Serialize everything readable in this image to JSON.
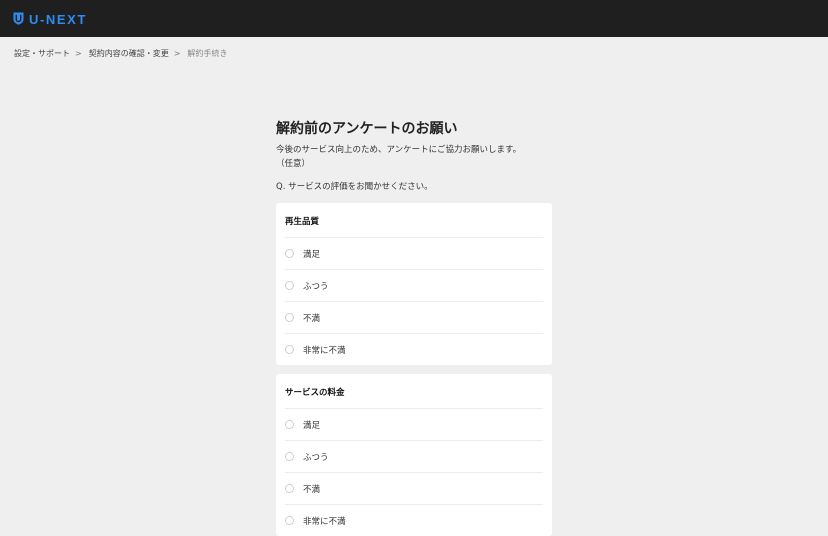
{
  "header": {
    "logo_text": "U-NEXT",
    "logo_icon": "u-next-shield-icon"
  },
  "breadcrumb": [
    {
      "label": "設定・サポート"
    },
    {
      "label": "契約内容の確認・変更"
    },
    {
      "label": "解約手続き"
    }
  ],
  "breadcrumb_sep": ">",
  "survey": {
    "title": "解約前のアンケートのお願い",
    "description": "今後のサービス向上のため、アンケートにご協力お願いします。",
    "optional_note": "（任意）",
    "question": "Q. サービスの評価をお聞かせください。",
    "groups": [
      {
        "title": "再生品質",
        "options": [
          "満足",
          "ふつう",
          "不満",
          "非常に不満"
        ]
      },
      {
        "title": "サービスの料金",
        "options": [
          "満足",
          "ふつう",
          "不満",
          "非常に不満"
        ]
      }
    ]
  },
  "colors": {
    "brand": "#2d8cf0",
    "header_bg": "#1f1f1f",
    "page_bg": "#efefef"
  }
}
